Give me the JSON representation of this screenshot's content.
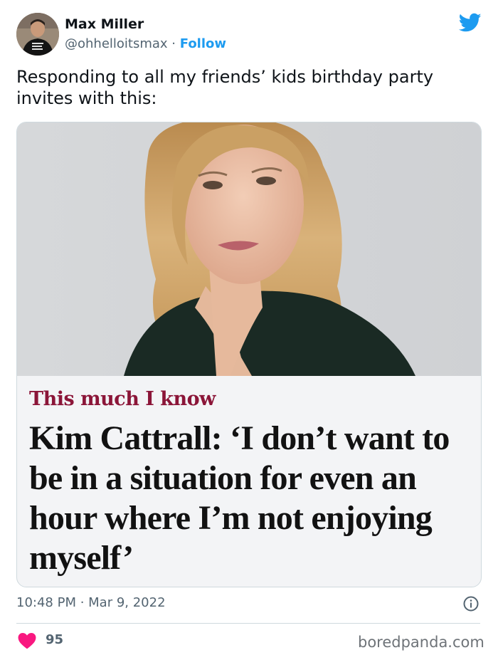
{
  "author": {
    "name": "Max Miller",
    "handle": "@ohhelloitsmax",
    "separator": " · ",
    "follow_label": "Follow"
  },
  "icons": {
    "brand": "twitter-bird-icon",
    "info": "info-circle-icon",
    "like": "heart-icon"
  },
  "tweet": {
    "text": "Responding to all my friends’ kids birthday party invites with this:"
  },
  "media": {
    "kicker": "This much I know",
    "headline": "Kim Cattrall: ‘I don’t want to be in a situation for even an hour where I’m not enjoying myself’"
  },
  "meta": {
    "time": "10:48 PM",
    "separator": " · ",
    "date": "Mar 9, 2022",
    "likes": "95"
  },
  "watermark": "boredpanda.com",
  "colors": {
    "accent": "#1d9bf0",
    "like": "#f91880",
    "kicker": "#8b1538"
  }
}
